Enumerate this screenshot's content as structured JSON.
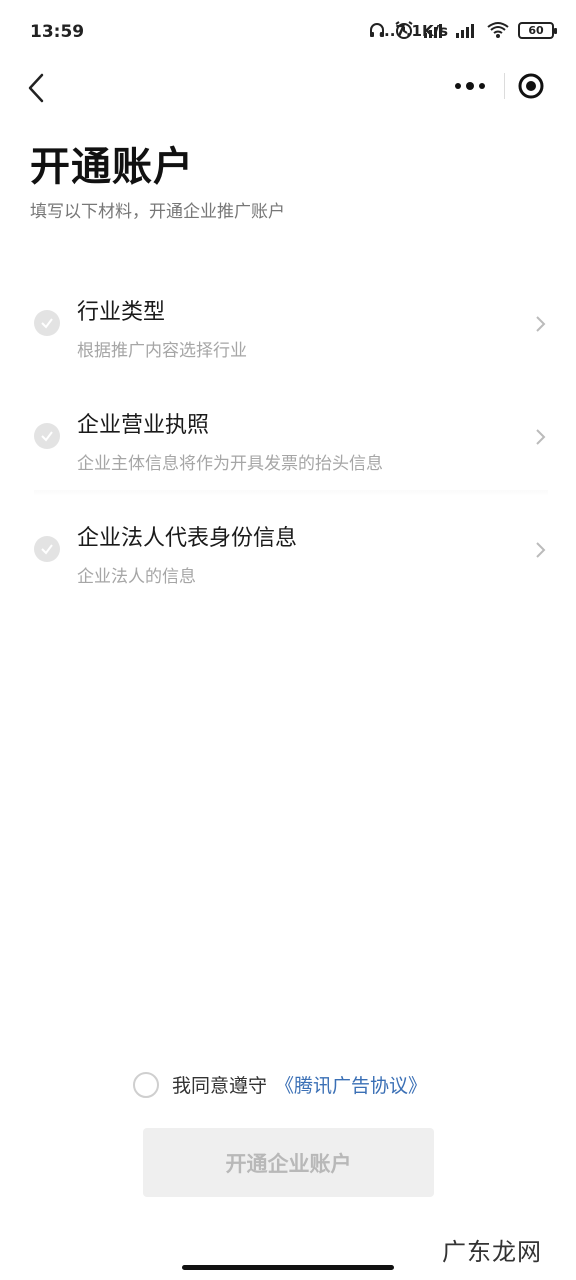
{
  "status_bar": {
    "time": "13:59",
    "net_speed": "...7.1K/s",
    "battery": "60"
  },
  "nav": {
    "back_icon": "chevron-left-icon",
    "more_icon": "more-dots-icon",
    "close_icon": "target-circle-icon"
  },
  "page": {
    "title": "开通账户",
    "subtitle": "填写以下材料，开通企业推广账户"
  },
  "steps": [
    {
      "title": "行业类型",
      "desc": "根据推广内容选择行业"
    },
    {
      "title": "企业营业执照",
      "desc": "企业主体信息将作为开具发票的抬头信息"
    },
    {
      "title": "企业法人代表身份信息",
      "desc": "企业法人的信息"
    }
  ],
  "agreement": {
    "text": "我同意遵守",
    "link": "《腾讯广告协议》"
  },
  "submit": {
    "label": "开通企业账户"
  },
  "watermark": "广东龙网",
  "colors": {
    "link": "#3a6fb5",
    "disabled_button_bg": "#efefef",
    "disabled_button_text": "#b8b8b8"
  }
}
